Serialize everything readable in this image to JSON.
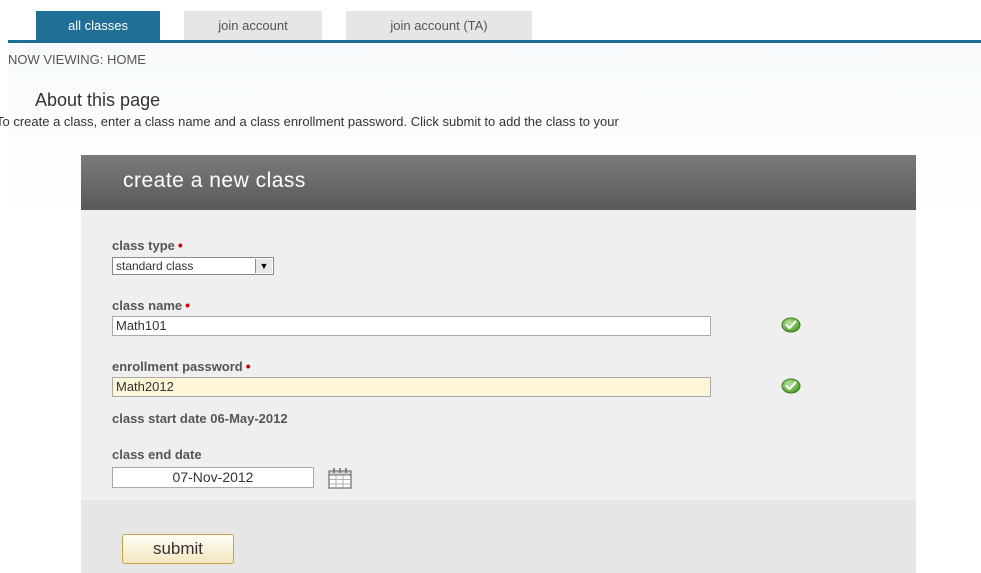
{
  "tabs": [
    {
      "label": "all classes",
      "active": true
    },
    {
      "label": "join account",
      "active": false
    },
    {
      "label": "join account (TA)",
      "active": false
    }
  ],
  "breadcrumb": "NOW VIEWING: HOME",
  "about": {
    "title": "About this page",
    "text": "To create a class, enter a class name and a class enrollment password. Click submit to add the class to your"
  },
  "panel": {
    "title": "create a new class"
  },
  "form": {
    "class_type": {
      "label": "class type",
      "value": "standard class"
    },
    "class_name": {
      "label": "class name",
      "value": "Math101"
    },
    "enrollment_password": {
      "label": "enrollment password",
      "value": "Math2012"
    },
    "class_start": "class start date 06-May-2012",
    "class_end": {
      "label": "class end date",
      "value": "07-Nov-2012"
    },
    "required_marker": "•"
  },
  "submit_label": "submit",
  "colors": {
    "tab_active": "#1f6f97",
    "panel_header": "#666666",
    "valid_check": "#5fb33a",
    "required": "#cc0000"
  }
}
